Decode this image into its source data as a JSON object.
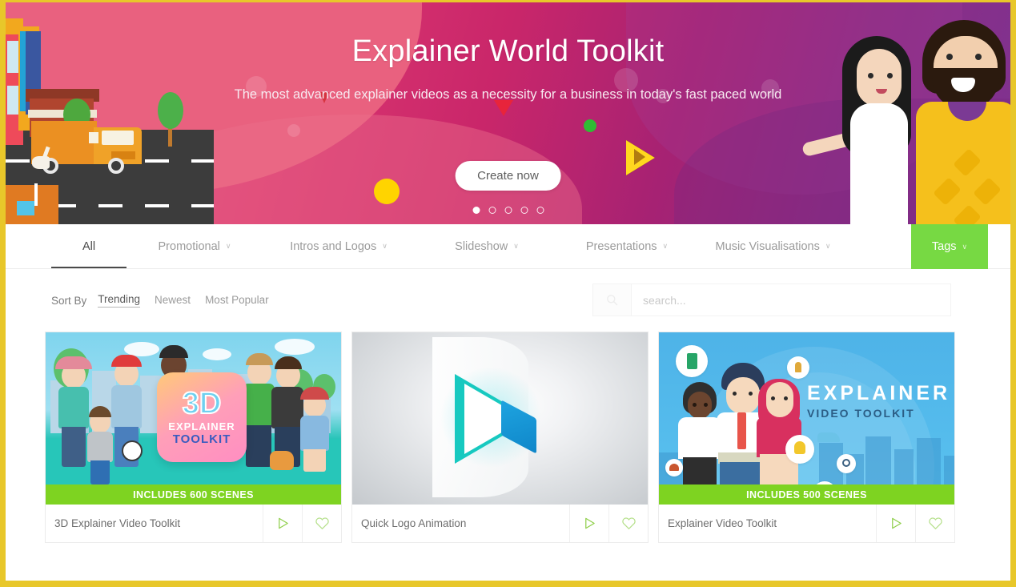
{
  "hero": {
    "title": "Explainer World Toolkit",
    "subtitle": "The most advanced explainer videos as a necessity for a business in today's fast paced world",
    "cta_label": "Create now",
    "carousel": {
      "total": 5,
      "active_index": 0
    },
    "colors": {
      "gradient_start": "#e8557f",
      "gradient_end": "#7e3391",
      "page_border": "#e8c72a"
    }
  },
  "nav": {
    "items": [
      {
        "label": "All",
        "has_caret": false,
        "active": true
      },
      {
        "label": "Promotional",
        "has_caret": true,
        "active": false
      },
      {
        "label": "Intros and Logos",
        "has_caret": true,
        "active": false
      },
      {
        "label": "Slideshow",
        "has_caret": true,
        "active": false
      },
      {
        "label": "Presentations",
        "has_caret": true,
        "active": false
      },
      {
        "label": "Music Visualisations",
        "has_caret": true,
        "active": false
      }
    ],
    "tags_button": {
      "label": "Tags",
      "has_caret": true,
      "color": "#77d943"
    },
    "caret_glyph": "∨"
  },
  "sort": {
    "label": "Sort By",
    "options": [
      {
        "label": "Trending",
        "active": true
      },
      {
        "label": "Newest",
        "active": false
      },
      {
        "label": "Most Popular",
        "active": false
      }
    ]
  },
  "search": {
    "placeholder": "search...",
    "value": "",
    "icon": "search-icon"
  },
  "cards": [
    {
      "title": "3D Explainer Video Toolkit",
      "scenes_badge": "INCLUDES 600 SCENES",
      "has_scenes_badge": true,
      "thumb_text": {
        "line1": "3D",
        "line2": "EXPLAINER",
        "line3": "TOOLKIT"
      },
      "actions": {
        "play": "play-icon",
        "favorite": "heart-icon"
      }
    },
    {
      "title": "Quick Logo Animation",
      "scenes_badge": "",
      "has_scenes_badge": false,
      "thumb_text": {
        "line1": "",
        "line2": "",
        "line3": ""
      },
      "actions": {
        "play": "play-icon",
        "favorite": "heart-icon"
      }
    },
    {
      "title": "Explainer Video Toolkit",
      "scenes_badge": "INCLUDES 500 SCENES",
      "has_scenes_badge": true,
      "thumb_text": {
        "line1": "",
        "line2": "EXPLAINER",
        "line3": "VIDEO TOOLKIT"
      },
      "actions": {
        "play": "play-icon",
        "favorite": "heart-icon"
      }
    }
  ]
}
